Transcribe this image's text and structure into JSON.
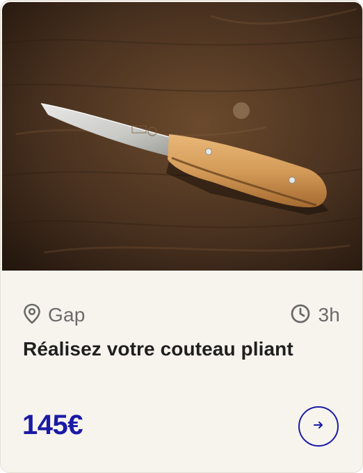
{
  "card": {
    "image_alt": "Couteau pliant avec manche en bois posé sur un établi",
    "location": "Gap",
    "location_icon": "map-pin-icon",
    "duration": "3h",
    "duration_icon": "clock-icon",
    "title": "Réalisez votre couteau pliant",
    "price": "145€",
    "action_icon": "arrow-right-icon"
  },
  "colors": {
    "accent": "#1a1aa6",
    "card_background": "#f7f4ee",
    "meta_text": "#6a6a6a",
    "title_text": "#1f1f1f"
  }
}
